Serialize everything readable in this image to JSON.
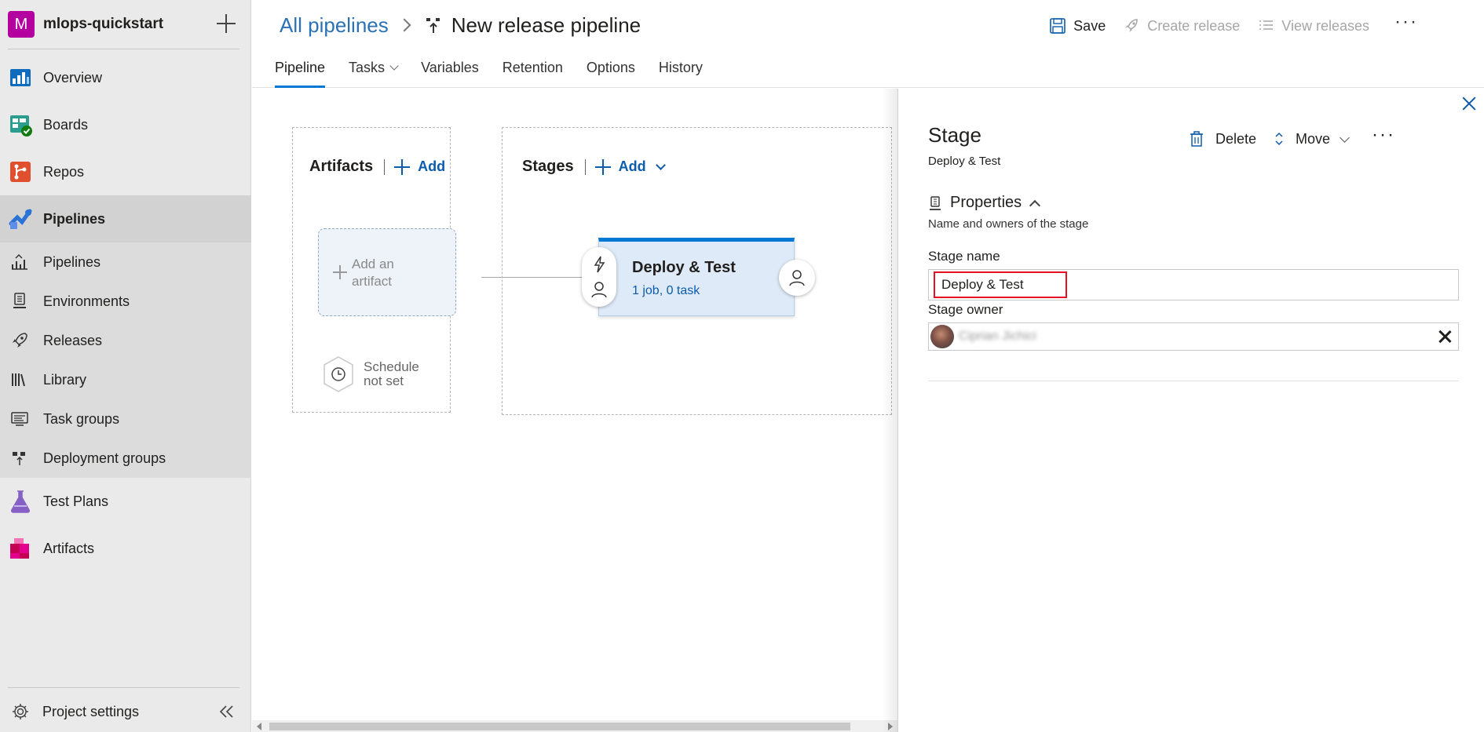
{
  "org": {
    "badge": "M",
    "name": "mlops-quickstart"
  },
  "nav": {
    "overview": "Overview",
    "boards": "Boards",
    "repos": "Repos",
    "pipelines": "Pipelines",
    "sub": {
      "pipelines": "Pipelines",
      "environments": "Environments",
      "releases": "Releases",
      "library": "Library",
      "task_groups": "Task groups",
      "deployment_groups": "Deployment groups"
    },
    "test_plans": "Test Plans",
    "artifacts": "Artifacts",
    "project_settings": "Project settings"
  },
  "header": {
    "breadcrumb_link": "All pipelines",
    "title": "New release pipeline",
    "save": "Save",
    "create_release": "Create release",
    "view_releases": "View releases",
    "more": "···"
  },
  "tabs": [
    "Pipeline",
    "Tasks",
    "Variables",
    "Retention",
    "Options",
    "History"
  ],
  "canvas": {
    "artifacts_title": "Artifacts",
    "artifacts_add": "Add",
    "add_artifact_line1": "Add an",
    "add_artifact_line2": "artifact",
    "schedule_line1": "Schedule",
    "schedule_line2": "not set",
    "stages_title": "Stages",
    "stages_add": "Add",
    "stage_name": "Deploy & Test",
    "stage_summary": "1 job, 0 task"
  },
  "panel": {
    "title": "Stage",
    "subtitle": "Deploy & Test",
    "delete": "Delete",
    "move": "Move",
    "more": "···",
    "properties_title": "Properties",
    "properties_desc": "Name and owners of the stage",
    "stage_name_label": "Stage name",
    "stage_name_value": "Deploy & Test",
    "stage_owner_label": "Stage owner",
    "stage_owner_value": "Ciprian Jichici"
  },
  "colors": {
    "accent": "#0078d4",
    "link": "#0b5cad",
    "highlight_border": "#e81123",
    "org_badge": "#b4009e"
  }
}
